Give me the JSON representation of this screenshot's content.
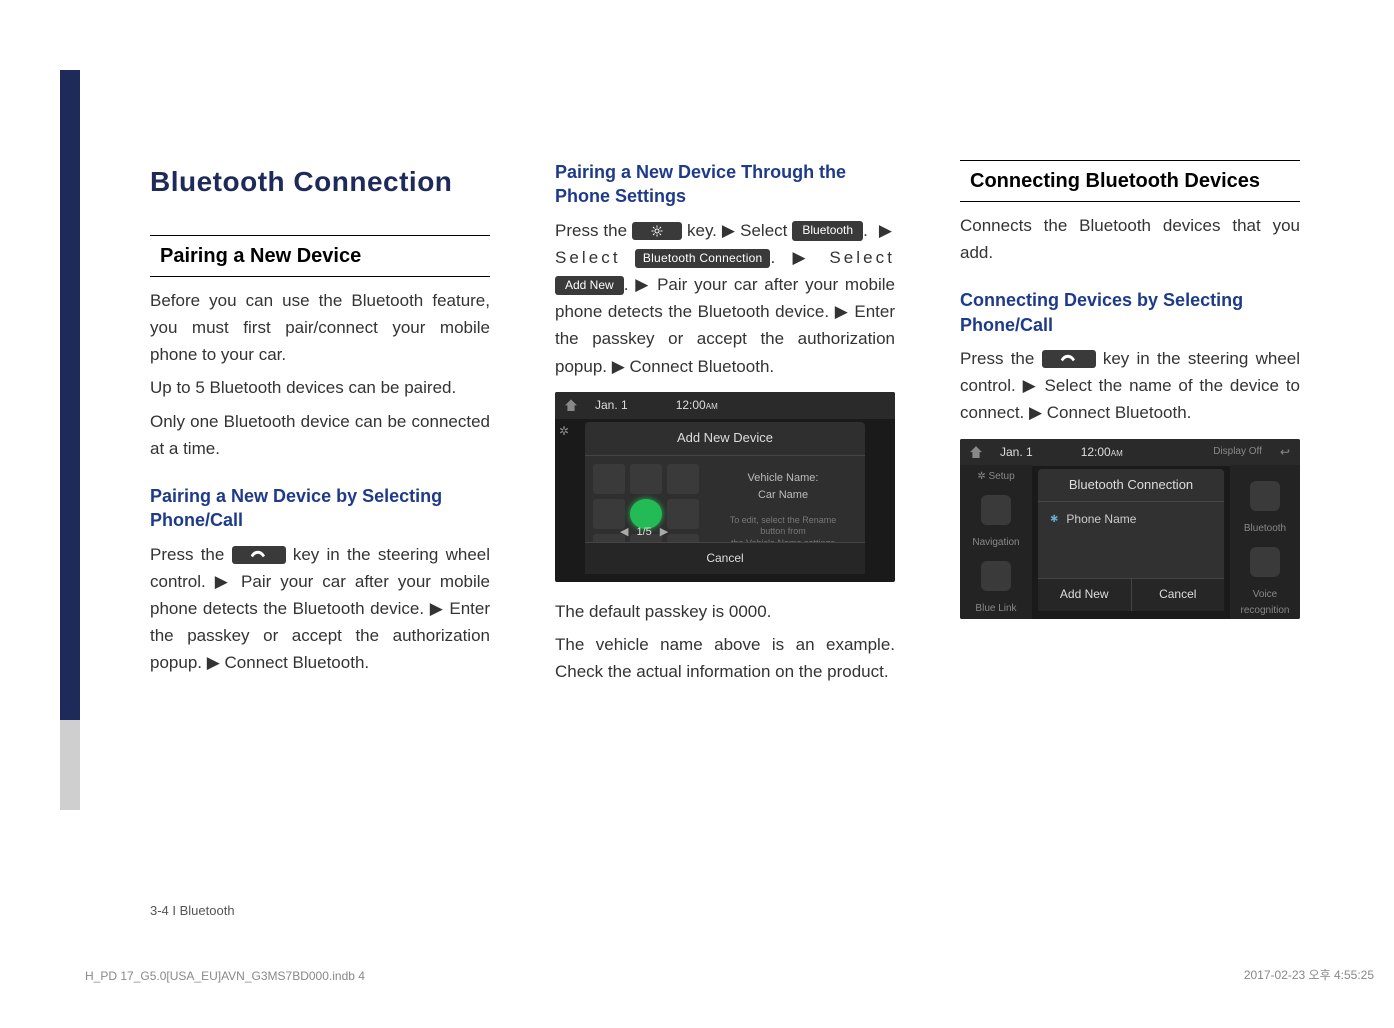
{
  "page_title": "Bluetooth Connection",
  "footer": "3-4 I Bluetooth",
  "print_meta_left": "H_PD 17_G5.0[USA_EU]AVN_G3MS7BD000.indb   4",
  "print_meta_right": "2017-02-23   오후 4:55:25",
  "col1": {
    "section": "Pairing a New Device",
    "intro1": "Before you can use the Bluetooth feature, you must first pair/connect your mobile phone to your car.",
    "intro2": "Up to 5 Bluetooth devices can be paired.",
    "intro3": "Only one Bluetooth device can be connected at a time.",
    "sub1": "Pairing a New Device by Selecting Phone/Call",
    "p1a": "Press the ",
    "p1b": " key in the steering wheel control. ▶ Pair your car after your mobile phone detects the Bluetooth device. ▶ Enter the passkey or accept the authorization popup. ▶ Connect Bluetooth."
  },
  "col2": {
    "sub": "Pairing a New Device Through the Phone Settings",
    "t1": "Press the ",
    "t2": " key. ▶ Select ",
    "btn_bt": "Bluetooth",
    "t3": ". ▶ Select ",
    "btn_btc": "Bluetooth Connection",
    "t4": ". ▶ Select ",
    "btn_add": "Add New",
    "t5": ". ▶ Pair your car after your mobile phone detects the Bluetooth device. ▶ Enter the passkey or accept the authorization popup. ▶ Connect Bluetooth.",
    "note1": "The default passkey is 0000.",
    "note2": "The vehicle name above is an example. Check the actual information on the product.",
    "device": {
      "date": "Jan.  1",
      "time": "12:00",
      "ampm": "AM",
      "title": "Add New Device",
      "vehicle_label": "Vehicle Name:",
      "vehicle_name": "Car Name",
      "small1": "To edit, select the Rename",
      "small2": "button from",
      "small3": "the Vehicle Name settings",
      "pager": "1/5",
      "cancel": "Cancel"
    }
  },
  "col3": {
    "section": "Connecting Bluetooth Devices",
    "intro": "Connects the Bluetooth devices that you add.",
    "sub": "Connecting Devices by Selecting Phone/Call",
    "p1a": "Press the ",
    "p1b": " key in the steering wheel control. ▶ Select the name of the device to connect. ▶ Connect Bluetooth.",
    "device": {
      "date": "Jan.  1",
      "time": "12:00",
      "ampm": "AM",
      "setup": "Setup",
      "title": "Bluetooth Connection",
      "phone": "Phone Name",
      "left1": "Navigation",
      "left2": "Blue Link",
      "right_top": "Display Off",
      "right1": "Bluetooth",
      "right2": "Voice recognition",
      "add": "Add New",
      "cancel": "Cancel"
    }
  }
}
